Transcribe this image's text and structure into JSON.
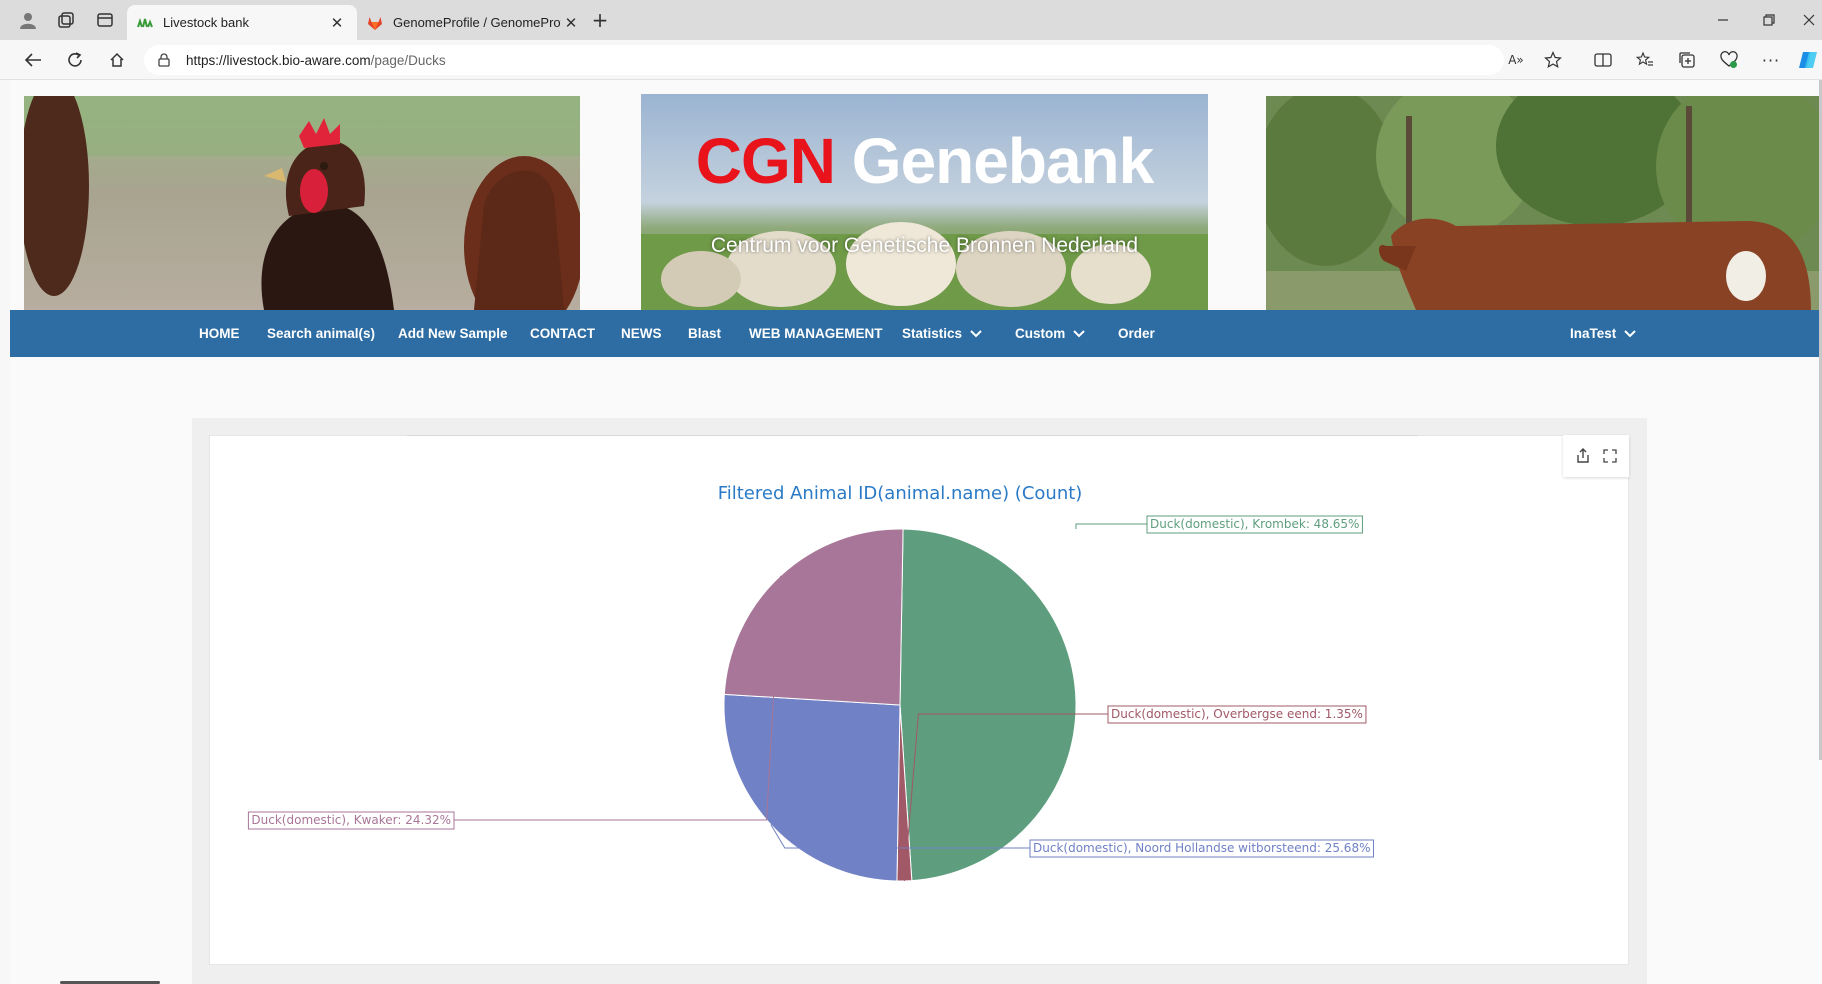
{
  "browser": {
    "tabs": [
      {
        "title": "Livestock bank",
        "active": true
      },
      {
        "title": "GenomeProfile / GenomeProfile",
        "active": false
      }
    ],
    "new_tab": "+",
    "url_host": "https://livestock.bio-aware.com",
    "url_path": "/page/Ducks",
    "read_aloud": "A»"
  },
  "site": {
    "title_red": "CGN",
    "title_white": "Genebank",
    "subtitle": "Centrum voor Genetische Bronnen Nederland"
  },
  "nav": {
    "items": [
      {
        "label": "HOME"
      },
      {
        "label": "Search animal(s)"
      },
      {
        "label": "Add New Sample"
      },
      {
        "label": "CONTACT"
      },
      {
        "label": "NEWS"
      },
      {
        "label": "Blast"
      },
      {
        "label": "WEB MANAGEMENT"
      },
      {
        "label": "Statistics"
      },
      {
        "label": "Custom"
      },
      {
        "label": "Order"
      }
    ],
    "user": "InaTest"
  },
  "colors": {
    "nav_bg": "#2d6da3",
    "title_red": "#e8131b",
    "chart_title": "#2a7ac7"
  },
  "chart_data": {
    "type": "pie",
    "title": "Filtered Animal ID(animal.name) (Count)",
    "slices": [
      {
        "label": "Duck(domestic), Krombek",
        "value": 48.65,
        "display": "Duck(domestic), Krombek: 48.65%",
        "color": "#5e9e7e"
      },
      {
        "label": "Duck(domestic), Overbergse eend",
        "value": 1.35,
        "display": "Duck(domestic), Overbergse eend: 1.35%",
        "color": "#a15867"
      },
      {
        "label": "Duck(domestic), Noord Hollandse witborsteend",
        "value": 25.68,
        "display": "Duck(domestic), Noord Hollandse witborsteend: 25.68%",
        "color": "#7081c5"
      },
      {
        "label": "Duck(domestic), Kwaker",
        "value": 24.32,
        "display": "Duck(domestic), Kwaker: 24.32%",
        "color": "#a87698"
      }
    ]
  }
}
